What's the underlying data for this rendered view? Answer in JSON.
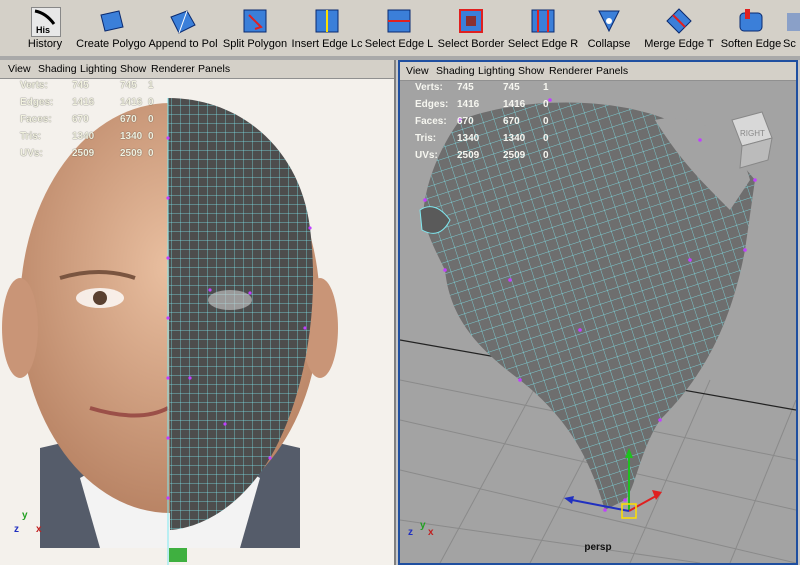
{
  "shelf": {
    "items": [
      {
        "label": "History",
        "icon": "history-icon",
        "icon_text": "His"
      },
      {
        "label": "Create Polygo",
        "icon": "create-polygon-icon"
      },
      {
        "label": "Append to Pol",
        "icon": "append-polygon-icon"
      },
      {
        "label": "Split Polygon",
        "icon": "split-polygon-icon"
      },
      {
        "label": "Insert Edge Lc",
        "icon": "insert-edge-loop-icon"
      },
      {
        "label": "Select Edge L",
        "icon": "select-edge-loop-icon"
      },
      {
        "label": "Select Border",
        "icon": "select-border-icon"
      },
      {
        "label": "Select Edge R",
        "icon": "select-edge-ring-icon"
      },
      {
        "label": "Collapse",
        "icon": "collapse-icon"
      },
      {
        "label": "Merge Edge T",
        "icon": "merge-edge-icon"
      },
      {
        "label": "Soften Edge",
        "icon": "soften-edge-icon"
      },
      {
        "label": "Sc",
        "icon": "sculpt-icon"
      }
    ]
  },
  "viewport_menu": [
    "View",
    "Shading",
    "Lighting",
    "Show",
    "Renderer",
    "Panels"
  ],
  "hud": [
    {
      "label": "Verts:",
      "a": "745",
      "b": "745",
      "c": "1"
    },
    {
      "label": "Edges:",
      "a": "1416",
      "b": "1416",
      "c": "0"
    },
    {
      "label": "Faces:",
      "a": "670",
      "b": "670",
      "c": "0"
    },
    {
      "label": "Tris:",
      "a": "1340",
      "b": "1340",
      "c": "0"
    },
    {
      "label": "UVs:",
      "a": "2509",
      "b": "2509",
      "c": "0"
    }
  ],
  "right_camera": "persp",
  "view_cube_label": "RIGHT",
  "axis_labels": {
    "x": "x",
    "y": "y",
    "z": "z"
  },
  "colors": {
    "wire": "#7fe8f0",
    "vertex": "#c040ff",
    "selection_blue": "#1f4fa0",
    "shelf_bg": "#d4d0c8"
  }
}
